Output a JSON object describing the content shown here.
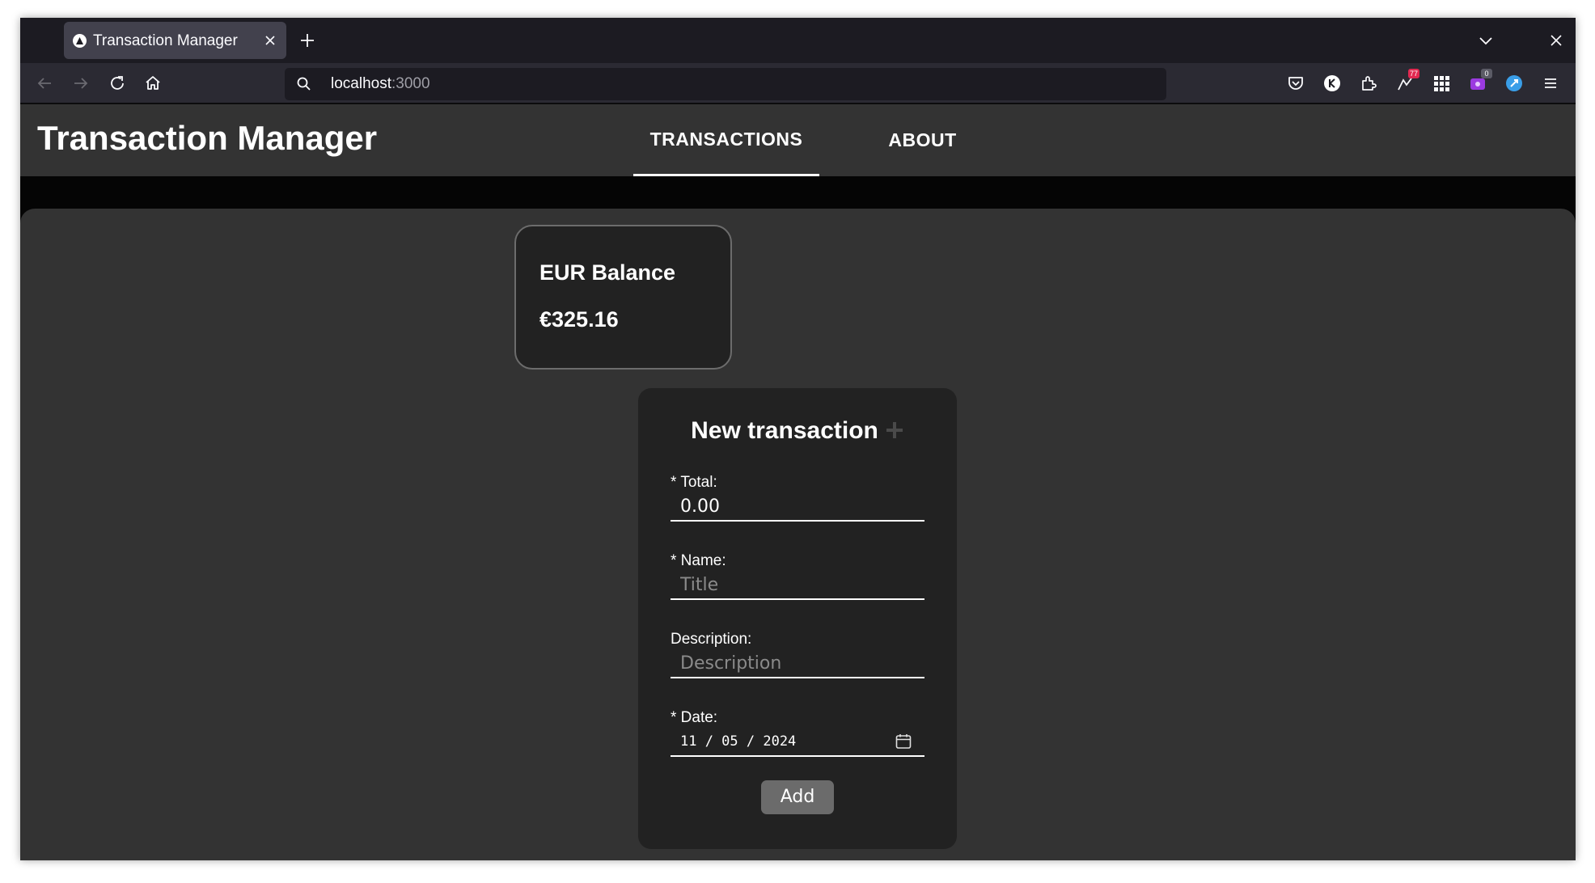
{
  "browser": {
    "tab": {
      "title": "Transaction Manager"
    },
    "url": {
      "host": "localhost",
      "port": ":3000"
    },
    "extensions": {
      "badge_red": "77",
      "badge_gray": "0"
    }
  },
  "app": {
    "title": "Transaction Manager",
    "nav": {
      "transactions": "TRANSACTIONS",
      "about": "ABOUT"
    },
    "balance": {
      "title": "EUR Balance",
      "value": "€325.16"
    },
    "form": {
      "title": "New transaction",
      "total_label": "* Total:",
      "total_value": "0.00",
      "name_label": "* Name:",
      "name_placeholder": "Title",
      "description_label": "Description:",
      "description_placeholder": "Description",
      "date_label": "* Date:",
      "date_value": "11 / 05 / 2024",
      "add_label": "Add"
    }
  },
  "colors": {
    "header_bg": "#333333",
    "card_bg": "#222222",
    "button_bg": "#6b6b6b"
  }
}
